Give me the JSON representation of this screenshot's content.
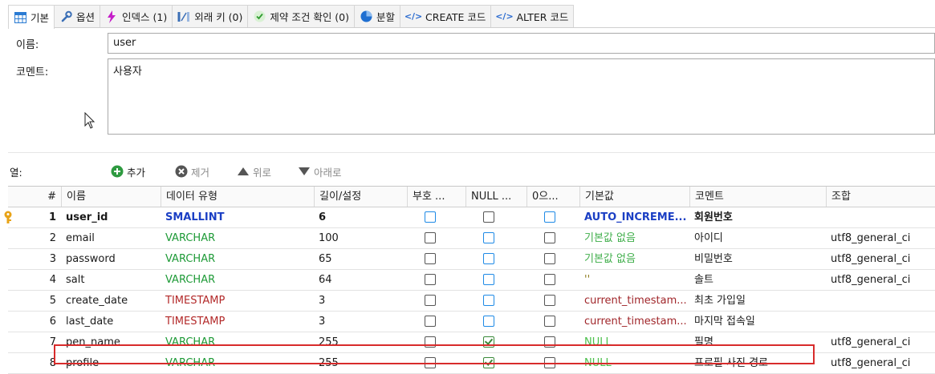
{
  "tabs": [
    {
      "label": "기본",
      "icon": "table-icon"
    },
    {
      "label": "옵션",
      "icon": "wrench-icon"
    },
    {
      "label": "인덱스 (1)",
      "icon": "lightning-icon"
    },
    {
      "label": "외래 키 (0)",
      "icon": "foreign-key-icon"
    },
    {
      "label": "제약 조건 확인 (0)",
      "icon": "check-icon"
    },
    {
      "label": "분할",
      "icon": "pie-icon"
    },
    {
      "label": "CREATE 코드",
      "icon": "code-icon"
    },
    {
      "label": "ALTER 코드",
      "icon": "code-icon"
    }
  ],
  "form": {
    "name_label": "이름:",
    "name_value": "user",
    "comment_label": "코멘트:",
    "comment_value": "사용자"
  },
  "columns_toolbar": {
    "label": "열:",
    "add": "추가",
    "remove": "제거",
    "up": "위로",
    "down": "아래로"
  },
  "grid": {
    "headers": [
      "#",
      "이름",
      "데이터 유형",
      "길이/설정",
      "부호 ...",
      "NULL ...",
      "0으...",
      "기본값",
      "코멘트",
      "조합"
    ],
    "rows": [
      {
        "num": "1",
        "name": "user_id",
        "type": "SMALLINT",
        "length": "6",
        "unsigned": false,
        "null": false,
        "zerofill": false,
        "default": "AUTO_INCREME...",
        "comment": "회원번호",
        "collation": "",
        "primary": true
      },
      {
        "num": "2",
        "name": "email",
        "type": "VARCHAR",
        "length": "100",
        "unsigned": false,
        "null": false,
        "zerofill": false,
        "default": "기본값 없음",
        "comment": "아이디",
        "collation": "utf8_general_ci"
      },
      {
        "num": "3",
        "name": "password",
        "type": "VARCHAR",
        "length": "65",
        "unsigned": false,
        "null": false,
        "zerofill": false,
        "default": "기본값 없음",
        "comment": "비밀번호",
        "collation": "utf8_general_ci"
      },
      {
        "num": "4",
        "name": "salt",
        "type": "VARCHAR",
        "length": "64",
        "unsigned": false,
        "null": false,
        "zerofill": false,
        "default": "''",
        "comment": "솔트",
        "collation": "utf8_general_ci"
      },
      {
        "num": "5",
        "name": "create_date",
        "type": "TIMESTAMP",
        "length": "3",
        "unsigned": false,
        "null": false,
        "zerofill": false,
        "default": "current_timestam...",
        "comment": "최초 가입일",
        "collation": ""
      },
      {
        "num": "6",
        "name": "last_date",
        "type": "TIMESTAMP",
        "length": "3",
        "unsigned": false,
        "null": false,
        "zerofill": false,
        "default": "current_timestam...",
        "comment": "마지막 접속일",
        "collation": ""
      },
      {
        "num": "7",
        "name": "pen_name",
        "type": "VARCHAR",
        "length": "255",
        "unsigned": false,
        "null": true,
        "zerofill": false,
        "default": "NULL",
        "comment": "필명",
        "collation": "utf8_general_ci"
      },
      {
        "num": "8",
        "name": "profile",
        "type": "VARCHAR",
        "length": "255",
        "unsigned": false,
        "null": true,
        "zerofill": false,
        "default": "NULL",
        "comment": "프로필 사진 경로",
        "collation": "utf8_general_ci"
      }
    ]
  },
  "colors": {
    "type_smallint": "#1b3fc4",
    "type_varchar": "#1e9a37",
    "type_timestamp": "#b32a2a",
    "default_auto": "#1b3fc4",
    "default_none": "#3fae4a",
    "default_timestamp": "#a0262a",
    "default_null": "#4cc04c",
    "default_str": "#8c7a1a",
    "highlight": "#d82b2b"
  }
}
